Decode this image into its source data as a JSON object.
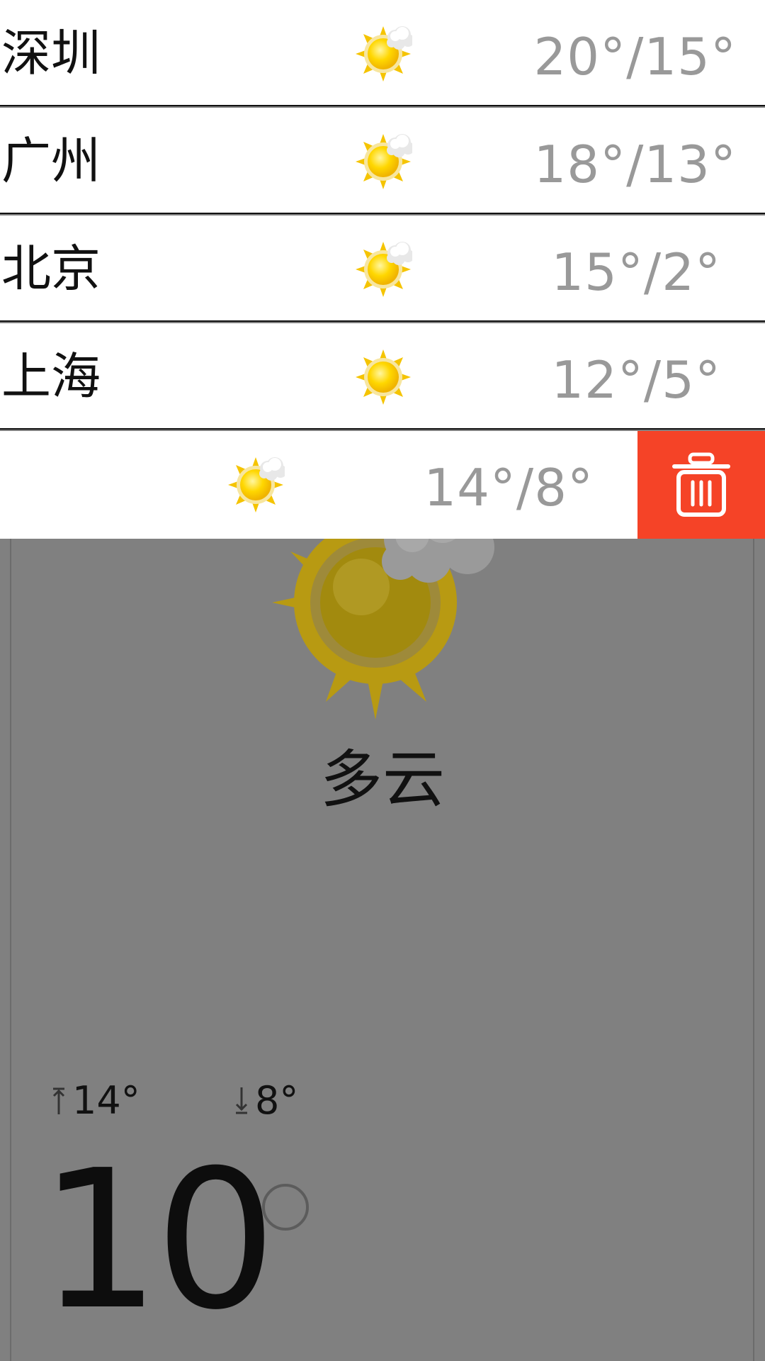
{
  "cities": [
    {
      "name": "深圳",
      "temp": "20°/15°",
      "icon": "partly-cloudy-icon"
    },
    {
      "name": "广州",
      "temp": "18°/13°",
      "icon": "partly-cloudy-icon"
    },
    {
      "name": "北京",
      "temp": "15°/2°",
      "icon": "partly-cloudy-icon"
    },
    {
      "name": "上海",
      "temp": "12°/5°",
      "icon": "sunny-icon"
    }
  ],
  "swiped_row": {
    "temp": "14°/8°",
    "icon": "partly-cloudy-icon",
    "action_icon": "trash-icon"
  },
  "current": {
    "condition": "多云",
    "high": "14°",
    "low": "8°",
    "temp": "10",
    "icon": "partly-cloudy-icon"
  },
  "colors": {
    "delete_bg": "#f54327",
    "overlay": "#808080",
    "temp_text": "#999999",
    "sun": "#ffd700"
  }
}
